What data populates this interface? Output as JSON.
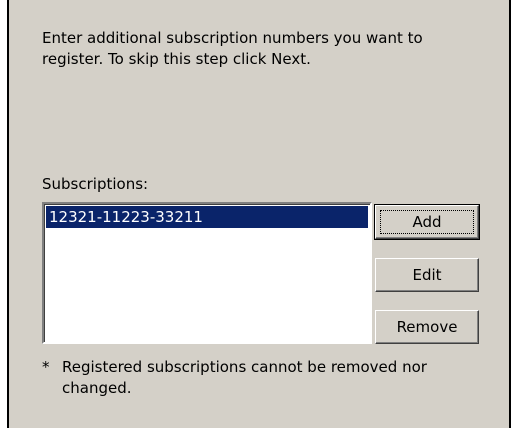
{
  "instructions": "Enter additional subscription numbers you want to register. To skip this step click Next.",
  "subscriptions": {
    "label": "Subscriptions:",
    "items": [
      {
        "value": "12321-11223-33211",
        "selected": true
      }
    ]
  },
  "buttons": {
    "add": "Add",
    "edit": "Edit",
    "remove": "Remove"
  },
  "note": {
    "marker": "*",
    "text": "Registered subscriptions cannot be removed nor changed."
  },
  "colors": {
    "dialog_bg": "#d4d0c8",
    "selection_bg": "#0a246a",
    "selection_text": "#ffffff",
    "listbox_bg": "#ffffff"
  }
}
